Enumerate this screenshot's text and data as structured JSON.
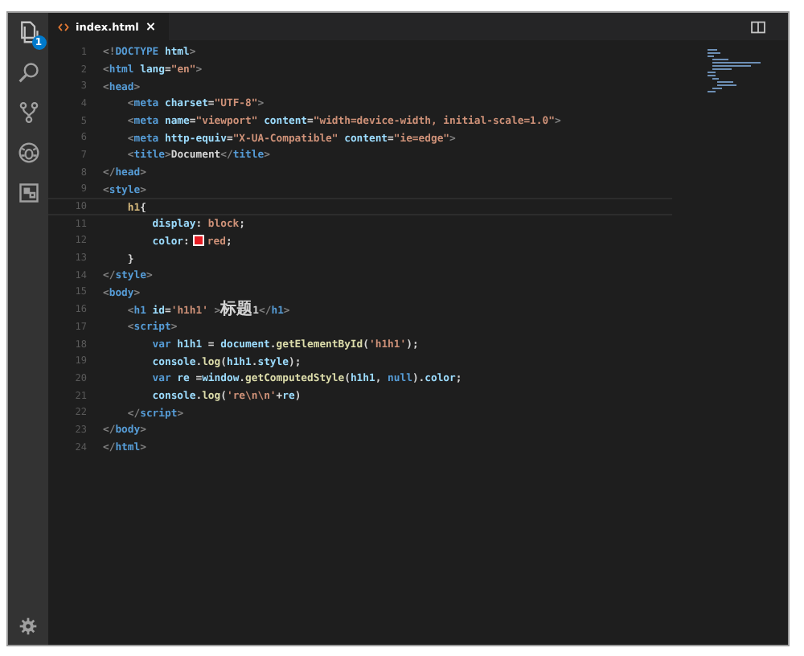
{
  "activity_bar": {
    "explorer_badge": "1"
  },
  "tabs": [
    {
      "label": "index.html",
      "selected": true,
      "close": "×"
    }
  ],
  "editor": {
    "lines": [
      {
        "number": "1",
        "tokens": [
          {
            "kind": "punct",
            "text": "<!"
          },
          {
            "kind": "tag",
            "text": "DOCTYPE"
          },
          {
            "kind": "attr",
            "text": " html"
          },
          {
            "kind": "punct",
            "text": ">"
          }
        ]
      },
      {
        "number": "2",
        "tokens": [
          {
            "kind": "punct",
            "text": "<"
          },
          {
            "kind": "tag",
            "text": "html"
          },
          {
            "kind": "attr",
            "text": " lang"
          },
          {
            "kind": "text",
            "text": "="
          },
          {
            "kind": "str",
            "text": "\"en\""
          },
          {
            "kind": "punct",
            "text": ">"
          }
        ]
      },
      {
        "number": "3",
        "tokens": [
          {
            "kind": "punct",
            "text": "<"
          },
          {
            "kind": "tag",
            "text": "head"
          },
          {
            "kind": "punct",
            "text": ">"
          }
        ]
      },
      {
        "number": "4",
        "tokens": [
          {
            "kind": "punct",
            "text": "    <"
          },
          {
            "kind": "tag",
            "text": "meta"
          },
          {
            "kind": "attr",
            "text": " charset"
          },
          {
            "kind": "text",
            "text": "="
          },
          {
            "kind": "str",
            "text": "\"UTF-8\""
          },
          {
            "kind": "punct",
            "text": ">"
          }
        ]
      },
      {
        "number": "5",
        "tokens": [
          {
            "kind": "punct",
            "text": "    <"
          },
          {
            "kind": "tag",
            "text": "meta"
          },
          {
            "kind": "attr",
            "text": " name"
          },
          {
            "kind": "text",
            "text": "="
          },
          {
            "kind": "str",
            "text": "\"viewport\""
          },
          {
            "kind": "attr",
            "text": " content"
          },
          {
            "kind": "text",
            "text": "="
          },
          {
            "kind": "str",
            "text": "\"width=device-width, initial-scale=1.0\""
          },
          {
            "kind": "punct",
            "text": ">"
          }
        ]
      },
      {
        "number": "6",
        "tokens": [
          {
            "kind": "punct",
            "text": "    <"
          },
          {
            "kind": "tag",
            "text": "meta"
          },
          {
            "kind": "attr",
            "text": " http-equiv"
          },
          {
            "kind": "text",
            "text": "="
          },
          {
            "kind": "str",
            "text": "\"X-UA-Compatible\""
          },
          {
            "kind": "attr",
            "text": " content"
          },
          {
            "kind": "text",
            "text": "="
          },
          {
            "kind": "str",
            "text": "\"ie=edge\""
          },
          {
            "kind": "punct",
            "text": ">"
          }
        ]
      },
      {
        "number": "7",
        "tokens": [
          {
            "kind": "punct",
            "text": "    <"
          },
          {
            "kind": "tag",
            "text": "title"
          },
          {
            "kind": "punct",
            "text": ">"
          },
          {
            "kind": "text",
            "text": "Document"
          },
          {
            "kind": "punct",
            "text": "</"
          },
          {
            "kind": "tag",
            "text": "title"
          },
          {
            "kind": "punct",
            "text": ">"
          }
        ]
      },
      {
        "number": "8",
        "tokens": [
          {
            "kind": "punct",
            "text": "</"
          },
          {
            "kind": "tag",
            "text": "head"
          },
          {
            "kind": "punct",
            "text": ">"
          }
        ]
      },
      {
        "number": "9",
        "tokens": [
          {
            "kind": "punct",
            "text": "<"
          },
          {
            "kind": "tag",
            "text": "style"
          },
          {
            "kind": "punct",
            "text": ">"
          }
        ]
      },
      {
        "number": "10",
        "current": true,
        "tokens": [
          {
            "kind": "selector",
            "text": "    h1"
          },
          {
            "kind": "bracket",
            "text": "{"
          }
        ]
      },
      {
        "number": "11",
        "tokens": [
          {
            "kind": "attr",
            "text": "        display"
          },
          {
            "kind": "text",
            "text": ": "
          },
          {
            "kind": "str",
            "text": "block"
          },
          {
            "kind": "text",
            "text": ";"
          }
        ]
      },
      {
        "number": "12",
        "tokens": [
          {
            "kind": "attr",
            "text": "        color"
          },
          {
            "kind": "text",
            "text": ":"
          },
          {
            "kind": "swatch",
            "color": "#e51c23"
          },
          {
            "kind": "str",
            "text": "red"
          },
          {
            "kind": "text",
            "text": ";"
          }
        ]
      },
      {
        "number": "13",
        "tokens": [
          {
            "kind": "bracket",
            "text": "    }"
          }
        ]
      },
      {
        "number": "14",
        "tokens": [
          {
            "kind": "punct",
            "text": "</"
          },
          {
            "kind": "tag",
            "text": "style"
          },
          {
            "kind": "punct",
            "text": ">"
          }
        ]
      },
      {
        "number": "15",
        "tokens": [
          {
            "kind": "punct",
            "text": "<"
          },
          {
            "kind": "tag",
            "text": "body"
          },
          {
            "kind": "punct",
            "text": ">"
          }
        ]
      },
      {
        "number": "16",
        "tokens": [
          {
            "kind": "punct",
            "text": "    <"
          },
          {
            "kind": "tag",
            "text": "h1"
          },
          {
            "kind": "attr",
            "text": " id"
          },
          {
            "kind": "text",
            "text": "="
          },
          {
            "kind": "str",
            "text": "'h1h1'"
          },
          {
            "kind": "punct",
            "text": " >"
          },
          {
            "kind": "cjk",
            "text": "标题"
          },
          {
            "kind": "text",
            "text": "1"
          },
          {
            "kind": "punct",
            "text": "</"
          },
          {
            "kind": "tag",
            "text": "h1"
          },
          {
            "kind": "punct",
            "text": ">"
          }
        ]
      },
      {
        "number": "17",
        "tokens": [
          {
            "kind": "punct",
            "text": "    <"
          },
          {
            "kind": "tag",
            "text": "script"
          },
          {
            "kind": "punct",
            "text": ">"
          }
        ]
      },
      {
        "number": "18",
        "tokens": [
          {
            "kind": "tag",
            "text": "        var"
          },
          {
            "kind": "attr",
            "text": " h1h1"
          },
          {
            "kind": "text",
            "text": " = "
          },
          {
            "kind": "attr",
            "text": "document"
          },
          {
            "kind": "text",
            "text": "."
          },
          {
            "kind": "func",
            "text": "getElementById"
          },
          {
            "kind": "text",
            "text": "("
          },
          {
            "kind": "str",
            "text": "'h1h1'"
          },
          {
            "kind": "text",
            "text": ");"
          }
        ]
      },
      {
        "number": "19",
        "tokens": [
          {
            "kind": "attr",
            "text": "        console"
          },
          {
            "kind": "text",
            "text": "."
          },
          {
            "kind": "func",
            "text": "log"
          },
          {
            "kind": "text",
            "text": "("
          },
          {
            "kind": "attr",
            "text": "h1h1"
          },
          {
            "kind": "text",
            "text": "."
          },
          {
            "kind": "attr",
            "text": "style"
          },
          {
            "kind": "text",
            "text": ");"
          }
        ]
      },
      {
        "number": "20",
        "tokens": [
          {
            "kind": "tag",
            "text": "        var"
          },
          {
            "kind": "attr",
            "text": " re"
          },
          {
            "kind": "text",
            "text": " ="
          },
          {
            "kind": "attr",
            "text": "window"
          },
          {
            "kind": "text",
            "text": "."
          },
          {
            "kind": "func",
            "text": "getComputedStyle"
          },
          {
            "kind": "text",
            "text": "("
          },
          {
            "kind": "attr",
            "text": "h1h1"
          },
          {
            "kind": "text",
            "text": ", "
          },
          {
            "kind": "tag",
            "text": "null"
          },
          {
            "kind": "text",
            "text": ")."
          },
          {
            "kind": "attr",
            "text": "color"
          },
          {
            "kind": "text",
            "text": ";"
          }
        ]
      },
      {
        "number": "21",
        "tokens": [
          {
            "kind": "attr",
            "text": "        console"
          },
          {
            "kind": "text",
            "text": "."
          },
          {
            "kind": "func",
            "text": "log"
          },
          {
            "kind": "text",
            "text": "("
          },
          {
            "kind": "str",
            "text": "'re\\n\\n'"
          },
          {
            "kind": "text",
            "text": "+"
          },
          {
            "kind": "attr",
            "text": "re"
          },
          {
            "kind": "text",
            "text": ")"
          }
        ]
      },
      {
        "number": "22",
        "tokens": [
          {
            "kind": "punct",
            "text": "    </"
          },
          {
            "kind": "tag",
            "text": "script"
          },
          {
            "kind": "punct",
            "text": ">"
          }
        ]
      },
      {
        "number": "23",
        "tokens": [
          {
            "kind": "punct",
            "text": "</"
          },
          {
            "kind": "tag",
            "text": "body"
          },
          {
            "kind": "punct",
            "text": ">"
          }
        ]
      },
      {
        "number": "24",
        "tokens": [
          {
            "kind": "punct",
            "text": "</"
          },
          {
            "kind": "tag",
            "text": "html"
          },
          {
            "kind": "punct",
            "text": ">"
          }
        ]
      }
    ]
  }
}
